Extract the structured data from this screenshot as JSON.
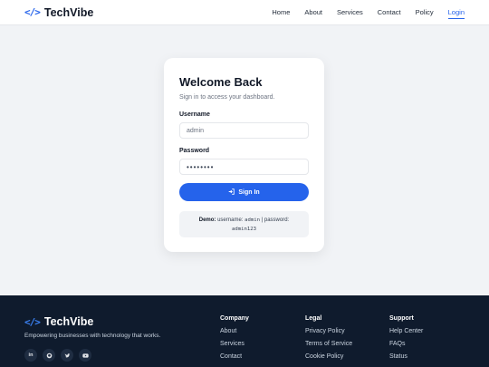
{
  "header": {
    "brand_icon": "</>",
    "brand_name": "TechVibe",
    "nav": [
      "Home",
      "About",
      "Services",
      "Contact",
      "Policy",
      "Login"
    ],
    "active_nav": "Login"
  },
  "card": {
    "title": "Welcome Back",
    "subtitle": "Sign in to access your dashboard.",
    "username_label": "Username",
    "username_value": "admin",
    "password_label": "Password",
    "password_value": "••••••••",
    "button_label": "Sign In",
    "button_icon": "sign-in-icon",
    "demo_label": "Demo:",
    "demo_username_text": "username:",
    "demo_username": "admin",
    "demo_password_text": "password:",
    "demo_password": "admin123"
  },
  "footer": {
    "brand_icon": "</>",
    "brand_name": "TechVibe",
    "tagline": "Empowering businesses with technology that works.",
    "socials": [
      "linkedin-icon",
      "github-icon",
      "twitter-icon",
      "youtube-icon"
    ],
    "columns": [
      {
        "title": "Company",
        "links": [
          "About",
          "Services",
          "Contact"
        ]
      },
      {
        "title": "Legal",
        "links": [
          "Privacy Policy",
          "Terms of Service",
          "Cookie Policy"
        ]
      },
      {
        "title": "Support",
        "links": [
          "Help Center",
          "FAQs",
          "Status"
        ]
      }
    ]
  },
  "colors": {
    "accent": "#2563eb",
    "footer_bg": "#0f1b2d",
    "page_bg": "#f1f3f6"
  }
}
